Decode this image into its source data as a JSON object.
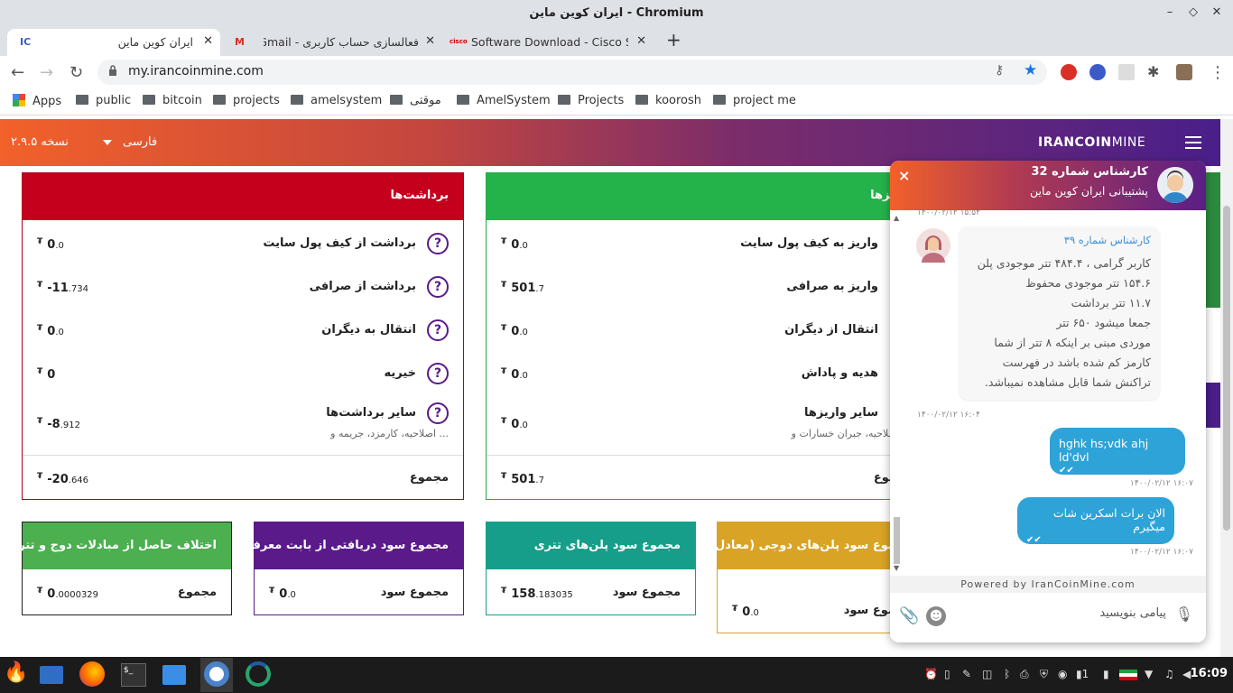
{
  "window": {
    "title": "ایران کوین ماین - Chromium"
  },
  "tabs": [
    {
      "label": "ایران کوین ماین",
      "favicon": "ic"
    },
    {
      "label": "فعالسازی حساب کاربری - Gmail",
      "favicon": "M"
    },
    {
      "label": "Software Download - Cisco Sys",
      "favicon": "cisco"
    }
  ],
  "new_tab": "+",
  "address": {
    "url": "my.irancoinmine.com"
  },
  "bookmarks": [
    {
      "label": "Apps"
    },
    {
      "label": "public"
    },
    {
      "label": "bitcoin"
    },
    {
      "label": "projects"
    },
    {
      "label": "amelsystem"
    },
    {
      "label": "موقتی"
    },
    {
      "label": "AmelSystem"
    },
    {
      "label": "Projects"
    },
    {
      "label": "koorosh"
    },
    {
      "label": "project me"
    }
  ],
  "header": {
    "version": "نسخه ۲.۹.۵",
    "language": "فارسی",
    "logo_bold": "IRANCOIN",
    "logo_light": "MINE"
  },
  "withdrawals": {
    "title": "برداشت‌ها",
    "rows": [
      {
        "label": "برداشت از کیف پول سایت",
        "value_int": "0",
        "value_dec": ".0"
      },
      {
        "label": "برداشت از صرافی",
        "value_int": "-11",
        "value_dec": ".734"
      },
      {
        "label": "انتقال به دیگران",
        "value_int": "0",
        "value_dec": ".0"
      },
      {
        "label": "خیریه",
        "value_int": "0",
        "value_dec": ""
      },
      {
        "label": "سایر برداشت‌ها",
        "value_int": "-8",
        "value_dec": ".912",
        "sub": "اصلاحیه، کارمزد، جریمه و ..."
      }
    ],
    "total_label": "مجموع",
    "total_int": "-20",
    "total_dec": ".646"
  },
  "deposits": {
    "title": "واریزها",
    "rows": [
      {
        "label": "واریز به کیف پول سایت",
        "value_int": "0",
        "value_dec": ".0"
      },
      {
        "label": "واریز به صرافی",
        "value_int": "501",
        "value_dec": ".7"
      },
      {
        "label": "انتقال از دیگران",
        "value_int": "0",
        "value_dec": ".0"
      },
      {
        "label": "هدیه و پاداش",
        "value_int": "0",
        "value_dec": ".0"
      },
      {
        "label": "سایر واریزها",
        "value_int": "0",
        "value_dec": ".0",
        "sub": "اصلاحیه، جبران خسارات و ..."
      }
    ],
    "total_label": "مجموع",
    "total_int": "501",
    "total_dec": ".7"
  },
  "currency_symbol": "₮",
  "summaries": [
    {
      "title": "اختلاف حاصل از مبادلات دوج و تتر",
      "label": "مجموع",
      "value_int": "0",
      "value_dec": ".0000329",
      "color": "#4caf50"
    },
    {
      "title": "مجموع سود دریافتی از بابت معرفی",
      "label": "مجموع سود",
      "value_int": "0",
      "value_dec": ".0",
      "color": "#5a1a8a"
    },
    {
      "title": "مجموع سود پلن‌های تتری",
      "label": "مجموع سود",
      "value_int": "158",
      "value_dec": ".183035",
      "color": "#169e8a"
    },
    {
      "title": "مجموع سود پلن‌های دوجی (معادل",
      "label": "مجموع سود",
      "value_int": "0",
      "value_dec": ".0",
      "color": "#d9a326"
    }
  ],
  "chat": {
    "agent_name": "کارشناس شماره 32",
    "agent_sub": "پشتیبانی ایران کوین ماین",
    "close": "×",
    "top_timestamp": "۱۴۰۰/۰۲/۱۲ ۱۵:۵۴",
    "incoming": {
      "who": "کارشناس شماره ۳۹",
      "lines": [
        "کاربر گرامی ، ۴۸۴.۴ تتر موجودی پلن",
        "۱۵۴.۶ تتر موجودی محفوظ",
        "۱۱.۷ تتر برداشت",
        "جمعا میشود ۶۵۰ تتر",
        "موردی مبنی بر اینکه ۸ تتر از شما",
        "کارمز کم شده باشد در فهرست",
        "تراکنش شما قابل مشاهده نمیباشد."
      ],
      "time": "۱۴۰۰/۰۲/۱۲ ۱۶:۰۴"
    },
    "outgoing": [
      {
        "text": "hghk hs;vdk ahj ld'dvl",
        "time": "۱۴۰۰/۰۲/۱۲ ۱۶:۰۷"
      },
      {
        "text": "الان برات اسکرین شات میگیرم",
        "time": "۱۴۰۰/۰۲/۱۲ ۱۶:۰۷"
      }
    ],
    "powered": "Powered by IranCoinMine.com",
    "input_placeholder": "پیامی بنویسید"
  },
  "taskbar": {
    "clock": "16:09",
    "tray_count": "1"
  }
}
